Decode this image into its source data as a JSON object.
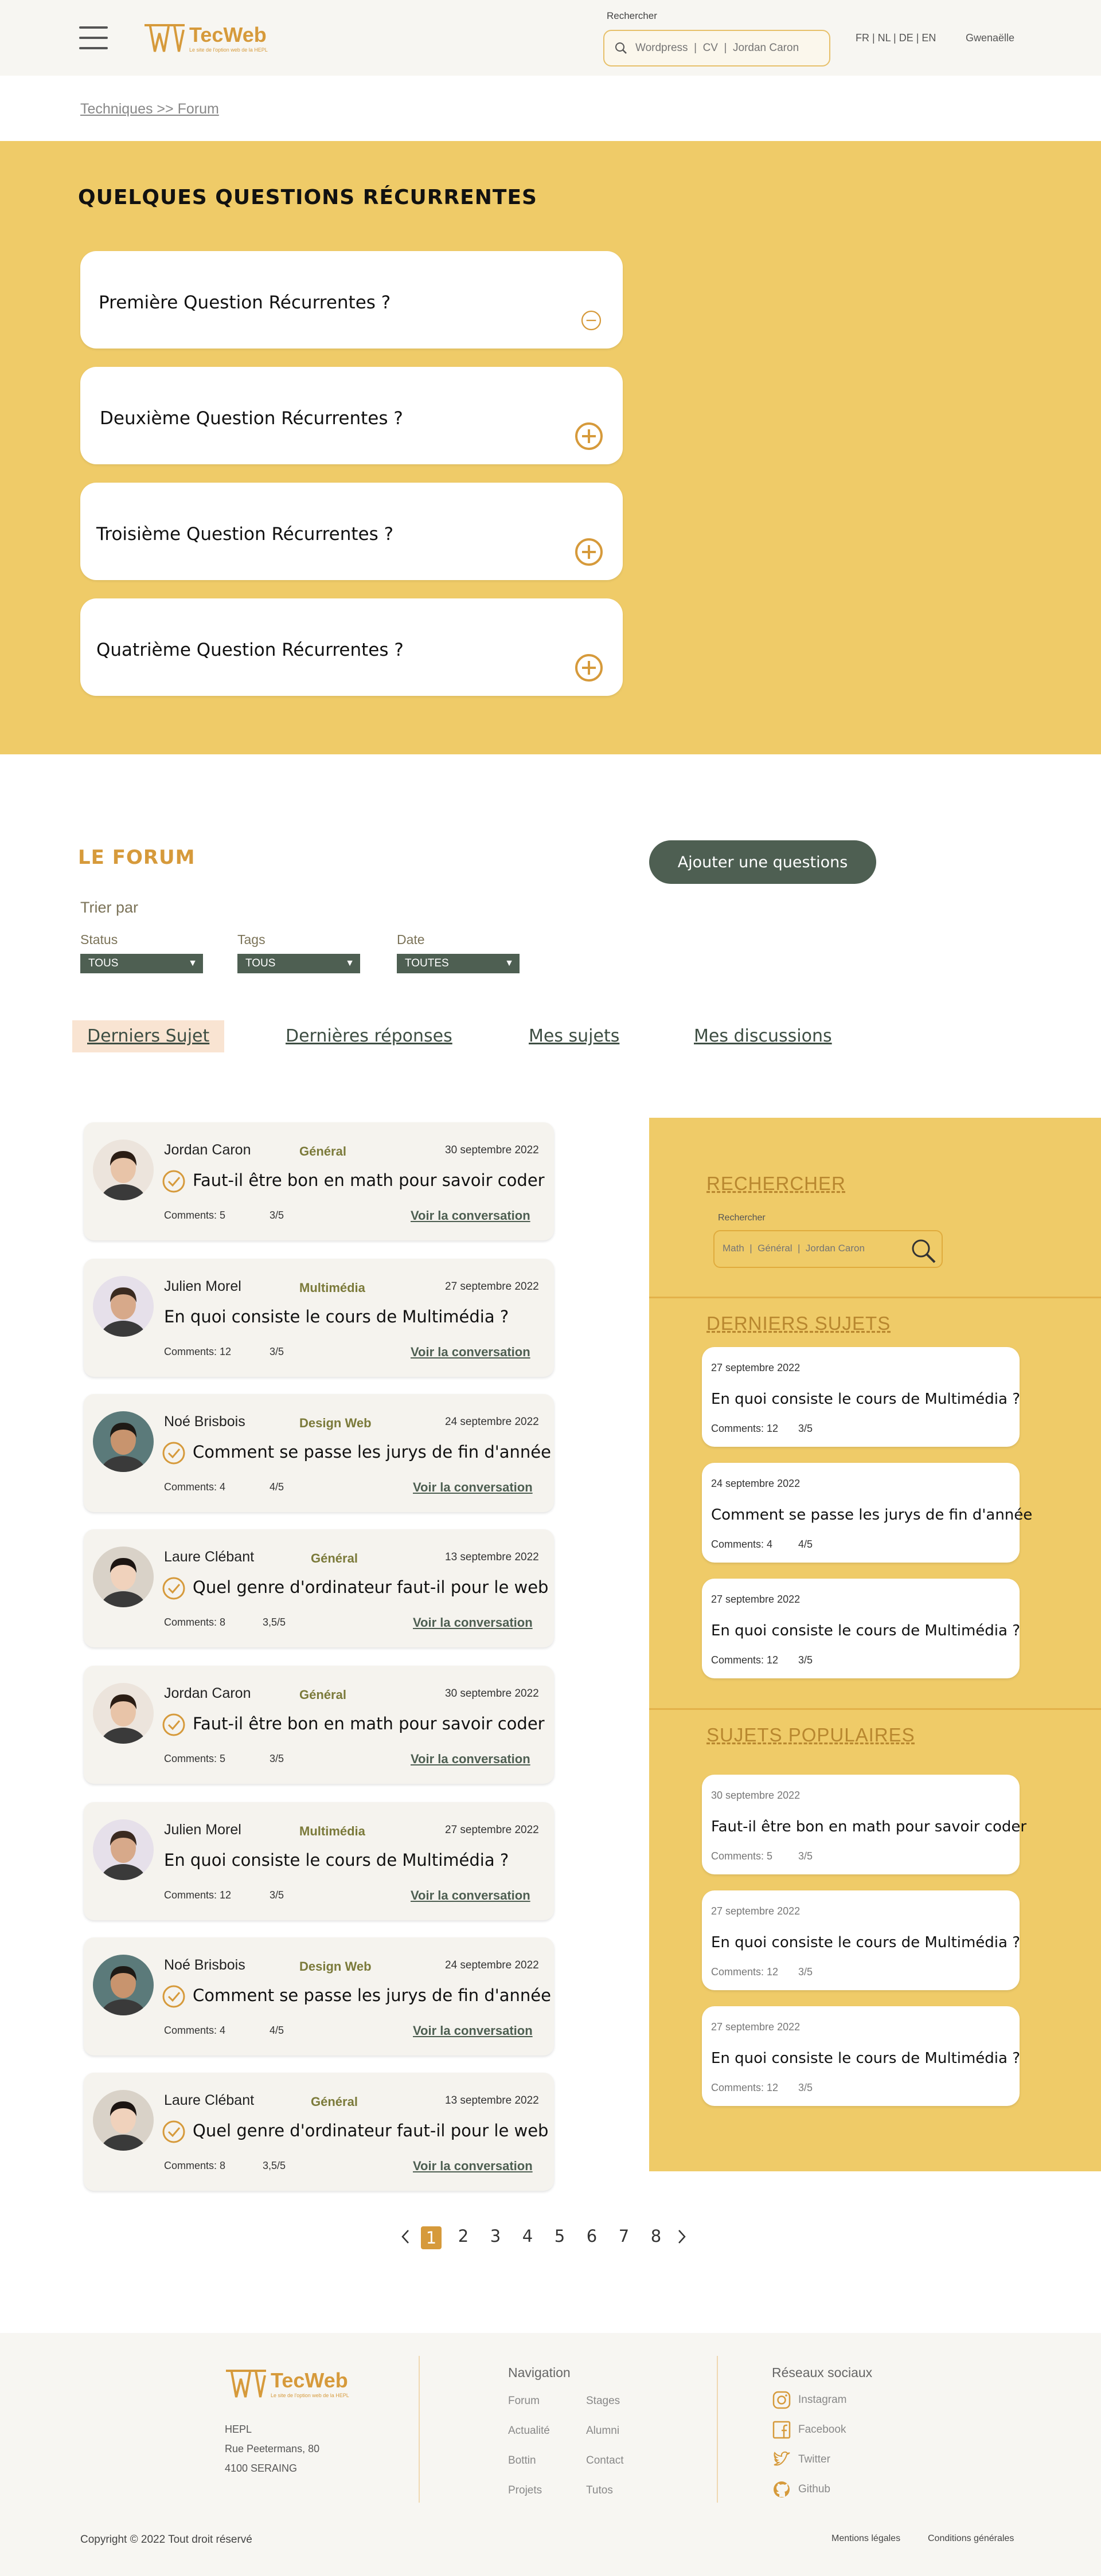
{
  "brand": {
    "name": "TecWeb",
    "tagline": "Le site de l'option web de la HEPL"
  },
  "header": {
    "search_label": "Rechercher",
    "search_placeholder": "Wordpress  |  CV  |  Jordan Caron",
    "languages": "FR | NL | DE | EN",
    "user": "Gwenaëlle"
  },
  "breadcrumb": "Techniques >> Forum",
  "faq": {
    "title": "QUELQUES QUESTIONS RÉCURRENTES",
    "items": [
      {
        "question": "Première Question Récurrentes ?",
        "state": "expanded"
      },
      {
        "question": "Deuxième Question Récurrentes ?",
        "state": "collapsed"
      },
      {
        "question": "Troisième Question Récurrentes ?",
        "state": "collapsed"
      },
      {
        "question": "Quatrième Question Récurrentes ?",
        "state": "collapsed"
      }
    ]
  },
  "forum": {
    "title": "LE FORUM",
    "add_button": "Ajouter une questions",
    "sort_label": "Trier par",
    "filters": [
      {
        "label": "Status",
        "value": "TOUS"
      },
      {
        "label": "Tags",
        "value": "TOUS"
      },
      {
        "label": "Date",
        "value": "TOUTES"
      }
    ],
    "tabs": [
      "Derniers Sujet",
      "Dernières réponses",
      "Mes sujets",
      "Mes discussions"
    ],
    "active_tab": "Derniers Sujet",
    "link_label": "Voir la conversation",
    "topics": [
      {
        "author": "Jordan Caron",
        "category": "Général",
        "date": "30 septembre 2022",
        "title": "Faut-il être bon en math pour savoir coder",
        "comments": "Comments: 5",
        "rating": "3/5",
        "resolved": true
      },
      {
        "author": "Julien Morel",
        "category": "Multimédia",
        "date": "27 septembre 2022",
        "title": "En quoi consiste le cours de Multimédia ?",
        "comments": "Comments: 12",
        "rating": "3/5",
        "resolved": false
      },
      {
        "author": "Noé Brisbois",
        "category": "Design Web",
        "date": "24 septembre 2022",
        "title": "Comment se passe les jurys de fin d'année",
        "comments": "Comments: 4",
        "rating": "4/5",
        "resolved": true
      },
      {
        "author": "Laure Clébant",
        "category": "Général",
        "date": "13 septembre 2022",
        "title": "Quel genre d'ordinateur faut-il pour le web",
        "comments": "Comments: 8",
        "rating": "3,5/5",
        "resolved": true
      },
      {
        "author": "Jordan Caron",
        "category": "Général",
        "date": "30 septembre 2022",
        "title": "Faut-il être bon en math pour savoir coder",
        "comments": "Comments: 5",
        "rating": "3/5",
        "resolved": true
      },
      {
        "author": "Julien Morel",
        "category": "Multimédia",
        "date": "27 septembre 2022",
        "title": "En quoi consiste le cours de Multimédia ?",
        "comments": "Comments: 12",
        "rating": "3/5",
        "resolved": false
      },
      {
        "author": "Noé Brisbois",
        "category": "Design Web",
        "date": "24 septembre 2022",
        "title": "Comment se passe les jurys de fin d'année",
        "comments": "Comments: 4",
        "rating": "4/5",
        "resolved": true
      },
      {
        "author": "Laure Clébant",
        "category": "Général",
        "date": "13 septembre 2022",
        "title": "Quel genre d'ordinateur faut-il pour le web",
        "comments": "Comments: 8",
        "rating": "3,5/5",
        "resolved": true
      }
    ]
  },
  "sidebar": {
    "search_title": "RECHERCHER",
    "search_label": "Rechercher",
    "search_placeholder": "Math  |  Général  |  Jordan Caron",
    "latest_title": "DERNIERS SUJETS",
    "latest": [
      {
        "date": "27 septembre 2022",
        "title": "En quoi consiste le cours de Multimédia ?",
        "comments": "Comments: 12",
        "rating": "3/5"
      },
      {
        "date": "24 septembre 2022",
        "title": "Comment se passe les jurys de fin d'année",
        "comments": "Comments: 4",
        "rating": "4/5"
      },
      {
        "date": "27 septembre 2022",
        "title": "En quoi consiste le cours de Multimédia ?",
        "comments": "Comments: 12",
        "rating": "3/5"
      }
    ],
    "popular_title": "SUJETS POPULAIRES",
    "popular": [
      {
        "date": "30 septembre 2022",
        "title": "Faut-il être bon en math pour savoir coder",
        "comments": "Comments: 5",
        "rating": "3/5"
      },
      {
        "date": "27 septembre 2022",
        "title": "En quoi consiste le cours de Multimédia ?",
        "comments": "Comments: 12",
        "rating": "3/5"
      },
      {
        "date": "27 septembre 2022",
        "title": "En quoi consiste le cours de Multimédia ?",
        "comments": "Comments: 12",
        "rating": "3/5"
      }
    ]
  },
  "pagination": {
    "pages": [
      "1",
      "2",
      "3",
      "4",
      "5",
      "6",
      "7",
      "8"
    ],
    "current": "1"
  },
  "footer": {
    "address": [
      "HEPL",
      "Rue Peetermans, 80",
      "4100 SERAING"
    ],
    "nav_title": "Navigation",
    "nav_col1": [
      "Forum",
      "Actualité",
      "Bottin",
      "Projets"
    ],
    "nav_col2": [
      "Stages",
      "Alumni",
      "Contact",
      "Tutos"
    ],
    "social_title": "Réseaux sociaux",
    "social": [
      {
        "label": "Instagram",
        "icon": "instagram-icon"
      },
      {
        "label": "Facebook",
        "icon": "facebook-icon"
      },
      {
        "label": "Twitter",
        "icon": "twitter-icon"
      },
      {
        "label": "Github",
        "icon": "github-icon"
      }
    ],
    "copyright": "Copyright © 2022 Tout droit réservé",
    "legal": [
      "Mentions légales",
      "Conditions générales"
    ]
  },
  "colors": {
    "accent": "#d69a3b",
    "yellow": "#efcb68",
    "dark_green": "#4e5f52",
    "light_bg": "#f7f6f2"
  }
}
